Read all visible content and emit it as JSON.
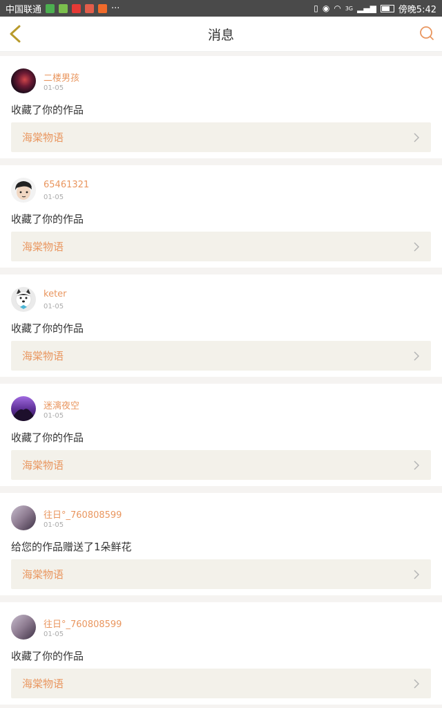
{
  "status_bar": {
    "carrier": "中国联通",
    "more": "···",
    "network": "3G",
    "time": "傍晚5:42"
  },
  "nav": {
    "title": "消息"
  },
  "messages": [
    {
      "username": "二楼男孩",
      "date": "01-05",
      "action": "收藏了你的作品",
      "work": "海棠物语"
    },
    {
      "username": "65461321",
      "date": "01-05",
      "action": "收藏了你的作品",
      "work": "海棠物语"
    },
    {
      "username": "keter",
      "date": "01-05",
      "action": "收藏了你的作品",
      "work": "海棠物语"
    },
    {
      "username": "迷漓夜空",
      "date": "01-05",
      "action": "收藏了你的作品",
      "work": "海棠物语"
    },
    {
      "username": "往日°_760808599",
      "date": "01-05",
      "action": "给您的作品赠送了1朵鲜花",
      "work": "海棠物语"
    },
    {
      "username": "往日°_760808599",
      "date": "01-05",
      "action": "收藏了你的作品",
      "work": "海棠物语"
    }
  ],
  "colors": {
    "accent": "#e9965f",
    "back_icon": "#b89a2b",
    "status_bar_bg": "#4a4a4a",
    "work_bg": "#f3f1ea"
  }
}
